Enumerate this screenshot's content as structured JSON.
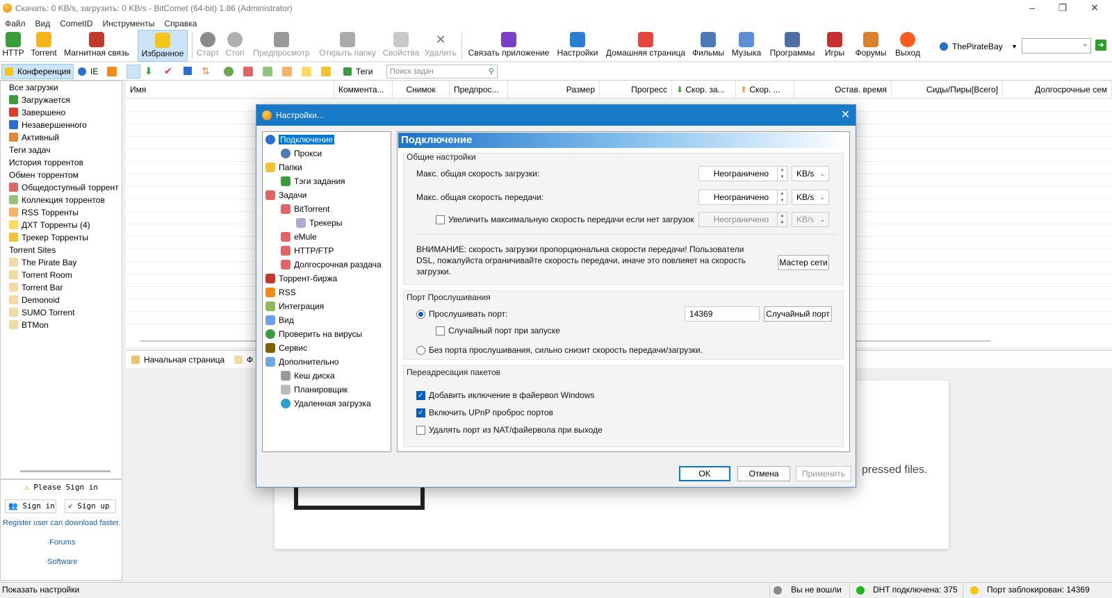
{
  "window": {
    "title": "Скачать: 0 KB/s, загрузить: 0 KB/s - BitComet (64-bit) 1.86 (Administrator)"
  },
  "menu": [
    "Файл",
    "Вид",
    "CometID",
    "Инструменты",
    "Справка"
  ],
  "toolbar": {
    "http": "HTTP",
    "torrent": "Torrent",
    "magnet": "Магнитная связь",
    "favorites": "Избранное",
    "start": "Старт",
    "stop": "Стоп",
    "preview": "Предпросмотр",
    "open_folder": "Открыть папку",
    "properties": "Свойства",
    "delete": "Удалить",
    "link_app": "Связать приложение",
    "settings": "Настройки",
    "home": "Домашняя страница",
    "movies": "Фильмы",
    "music": "Музыка",
    "programs": "Программы",
    "games": "Игры",
    "forums": "Форумы",
    "exit": "Выход",
    "search_engine": "ThePirateBay"
  },
  "tabrow": {
    "conference": "Конференция",
    "ie": "IE",
    "tags": "Теги",
    "search_placeholder": "Поиск задач"
  },
  "sidebar": {
    "items": [
      {
        "label": "Все загрузки",
        "icon": "none-icon"
      },
      {
        "label": "Загружается",
        "icon": "download-arrow-icon"
      },
      {
        "label": "Завершено",
        "icon": "checkmark-icon"
      },
      {
        "label": "Незавершенного",
        "icon": "incomplete-icon"
      },
      {
        "label": "Активный",
        "icon": "active-icon"
      },
      {
        "label": "Теги задач",
        "icon": "tag-icon"
      },
      {
        "label": "История торрентов",
        "icon": "none-icon"
      },
      {
        "label": "Обмен торрентом",
        "icon": "none-icon"
      },
      {
        "label": "Общедоступный торрент",
        "icon": "public-torrent-icon"
      },
      {
        "label": "Коллекция торрентов",
        "icon": "collection-icon"
      },
      {
        "label": "RSS Торренты",
        "icon": "rss-icon"
      },
      {
        "label": "ДХТ Торренты (4)",
        "icon": "dht-icon"
      },
      {
        "label": "Трекер Торренты",
        "icon": "tracker-icon"
      },
      {
        "label": "Torrent Sites",
        "icon": "none-icon"
      },
      {
        "label": "The Pirate Bay",
        "icon": "site-icon"
      },
      {
        "label": "Torrent Room",
        "icon": "site-icon"
      },
      {
        "label": "Torrent Bar",
        "icon": "site-icon"
      },
      {
        "label": "Demonoid",
        "icon": "site-icon"
      },
      {
        "label": "SUMO Torrent",
        "icon": "site-icon"
      },
      {
        "label": "BTMon",
        "icon": "site-icon"
      }
    ]
  },
  "signpanel": {
    "please": "Please Sign in",
    "signin": "Sign in",
    "signup": "Sign up",
    "register": "Register user can download faster.",
    "forums": "·Forums",
    "software": "·Software"
  },
  "columns": [
    "Имя",
    "Коммента...",
    "Снимок",
    "Предпрос...",
    "Размер",
    "Прогресс",
    "Скор. за...",
    "Скор. ...",
    "Остав. время",
    "Сиды/Пиры[Всего]",
    "Долгосрочные сем"
  ],
  "bottomtabs": {
    "home": "Начальная страница",
    "f": "Ф"
  },
  "bottompane": {
    "text": "pressed files."
  },
  "status": {
    "left": "Показать настройки",
    "login": "Вы не вошли",
    "dht": "DHT подключена: 375",
    "port": "Порт заблокирован: 14369"
  },
  "dialog": {
    "title": "Настройки...",
    "tree": [
      {
        "label": "Подключение",
        "icon": "globe-icon"
      },
      {
        "label": "Прокси",
        "icon": "proxy-icon"
      },
      {
        "label": "Папки",
        "icon": "folder-icon"
      },
      {
        "label": "Тэги задания",
        "icon": "tag-icon"
      },
      {
        "label": "Задачи",
        "icon": "tasks-icon"
      },
      {
        "label": "BitTorrent",
        "icon": "bittorrent-icon"
      },
      {
        "label": "Трекеры",
        "icon": "tracker-icon"
      },
      {
        "label": "eMule",
        "icon": "emule-icon"
      },
      {
        "label": "HTTP/FTP",
        "icon": "http-icon"
      },
      {
        "label": "Долгосрочная раздача",
        "icon": "seeding-icon"
      },
      {
        "label": "Торрент-биржа",
        "icon": "magnet-icon"
      },
      {
        "label": "RSS",
        "icon": "rss-icon"
      },
      {
        "label": "Интеграция",
        "icon": "integration-icon"
      },
      {
        "label": "Вид",
        "icon": "view-icon"
      },
      {
        "label": "Проверить на вирусы",
        "icon": "shield-icon"
      },
      {
        "label": "Сервис",
        "icon": "service-icon"
      },
      {
        "label": "Дополнительно",
        "icon": "advanced-icon"
      },
      {
        "label": "Кеш диска",
        "icon": "disk-icon"
      },
      {
        "label": "Планировщик",
        "icon": "scheduler-icon"
      },
      {
        "label": "Удаленная загрузка",
        "icon": "remote-icon"
      }
    ],
    "panel_title": "Подключение",
    "general": {
      "label": "Общие настройки",
      "max_dl_label": "Макс. общая скорость загрузки:",
      "max_dl_value": "Неограничено",
      "max_dl_unit": "KB/s",
      "max_ul_label": "Макс. общая скорость передачи:",
      "max_ul_value": "Неограничено",
      "max_ul_unit": "KB/s",
      "boost_label": "Увеличить максимальную скорость передачи если нет загрузок",
      "boost_value": "Неограничено",
      "boost_unit": "KB/s",
      "boost_checked": false,
      "warning": "ВНИМАНИЕ: скорость загрузки пропорциональна скорости передачи! Пользователи DSL, пожалуйста ограничивайте скорость передачи, иначе это повлияет на скорость загрузки.",
      "wizard": "Мастер сети"
    },
    "listen": {
      "label": "Порт Прослушивания",
      "listen_port_label": "Прослушивать порт:",
      "port_value": "14369",
      "random_port_btn": "Случайный порт",
      "random_on_start": "Случайный порт при запуске",
      "no_port": "Без порта прослушивания, сильно снизит скорость передачи/загрузки."
    },
    "forward": {
      "label": "Переадресация пакетов",
      "firewall": "Добавить иключение в файервол Windows",
      "upnp": "Включить UPnP проброс портов",
      "remove": "Удалять порт из NAT/файервола при выходе"
    },
    "buttons": {
      "ok": "OK",
      "cancel": "Отмена",
      "apply": "Применить"
    }
  }
}
